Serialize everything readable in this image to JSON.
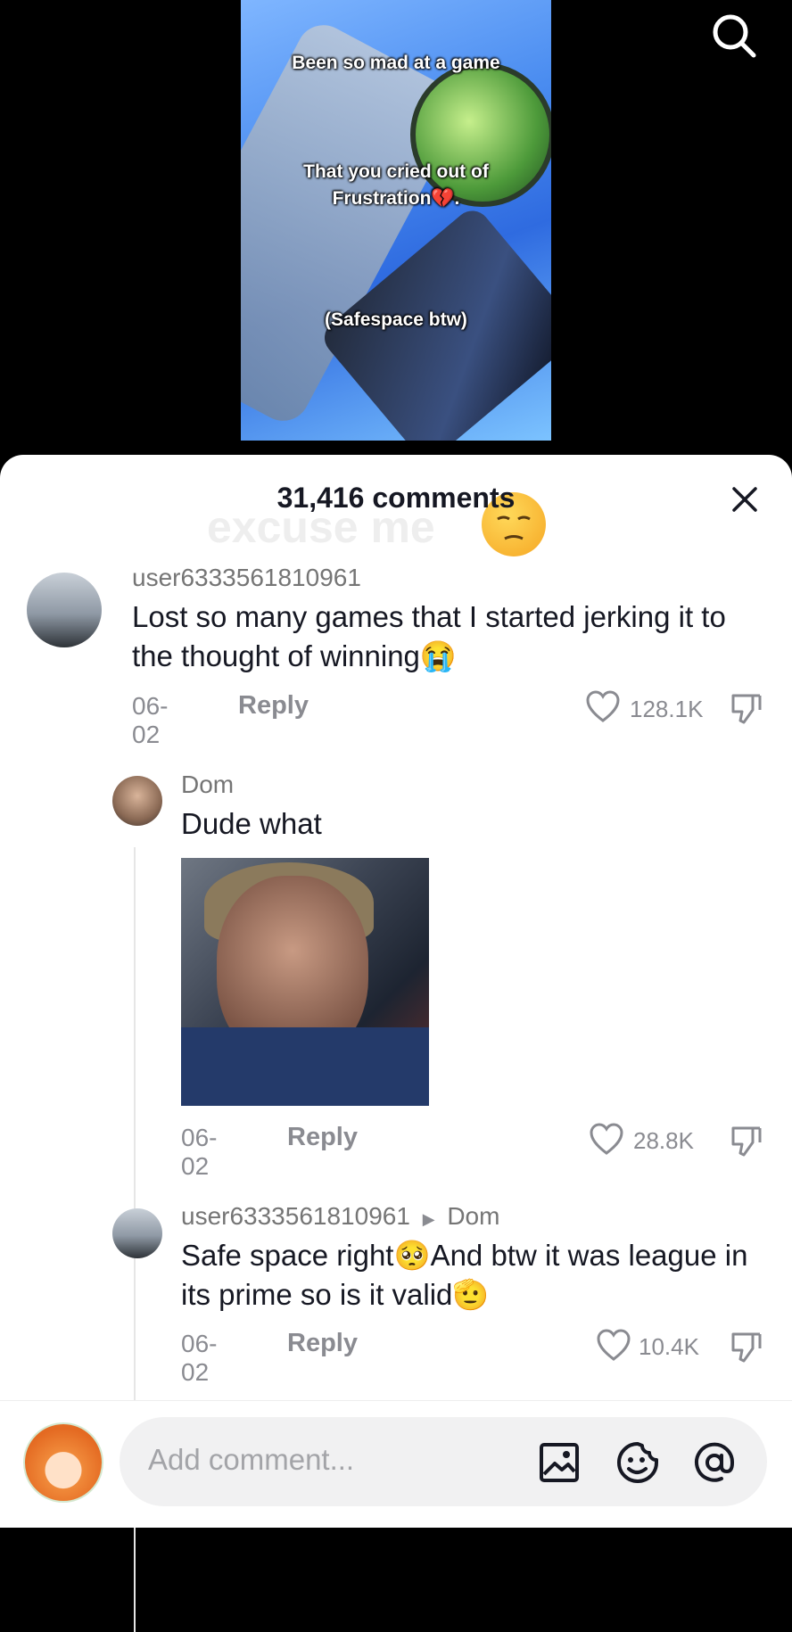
{
  "video": {
    "caption_1": "Been so mad at a game",
    "caption_2": "That you cried out of",
    "caption_3": "Frustration💔.",
    "caption_4": "(Safespace btw)"
  },
  "header": {
    "comment_count": "31,416 comments",
    "watermark": "excuse me"
  },
  "comments": [
    {
      "username": "user6333561810961",
      "text": "Lost so many games that I started jerking it to the thought of winning😭",
      "date": "06-02",
      "reply_label": "Reply",
      "likes": "128.1K"
    },
    {
      "username": "Dom",
      "text": "Dude what",
      "date": "06-02",
      "reply_label": "Reply",
      "likes": "28.8K"
    },
    {
      "username": "user6333561810961",
      "reply_to": "Dom",
      "text": "Safe space right🥺And btw it was league in its prime so is it valid🫡",
      "date": "06-02",
      "reply_label": "Reply",
      "likes": "10.4K"
    }
  ],
  "composer": {
    "placeholder": "Add comment..."
  },
  "icons": {
    "search": "search-icon",
    "close": "close-icon",
    "like": "heart-icon",
    "dislike": "dislike-icon",
    "image": "image-icon",
    "emoji": "emoji-icon",
    "mention": "at-icon"
  }
}
